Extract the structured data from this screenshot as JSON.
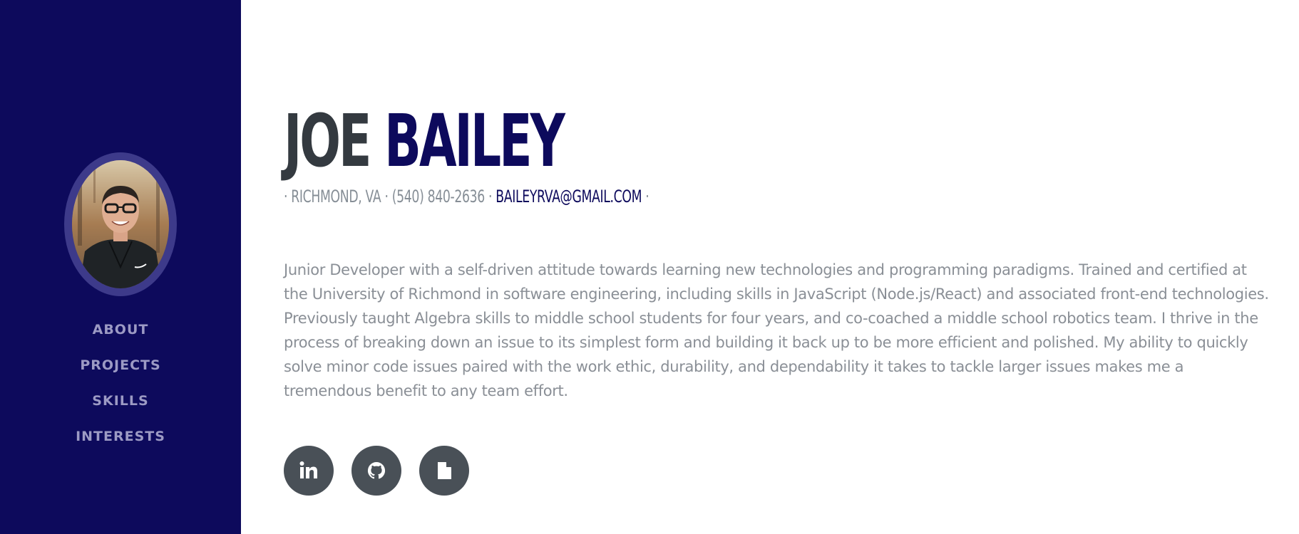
{
  "profile": {
    "first_name": "JOE",
    "last_name": "BAILEY",
    "sep1": "· ",
    "location": "RICHMOND, VA",
    "sep2": " · ",
    "phone": "(540) 840-2636",
    "sep3": " · ",
    "email": "BAILEYRVA@GMAIL.COM",
    "sep4": " ·",
    "bio": "Junior Developer with a self-driven attitude towards learning new technologies and programming paradigms. Trained and certified at the University of Richmond in software engineering, including skills in JavaScript (Node.js/React) and associated front-end technologies. Previously taught Algebra skills to middle school students for four years, and co-coached a middle school robotics team. I thrive in the process of breaking down an issue to its simplest form and building it back up to be more efficient and polished. My ability to quickly solve minor code issues paired with the work ethic, durability, and dependability it takes to tackle larger issues makes me a tremendous benefit to any team effort."
  },
  "sidebar": {
    "nav": [
      {
        "label": "ABOUT"
      },
      {
        "label": "PROJECTS"
      },
      {
        "label": "SKILLS"
      },
      {
        "label": "INTERESTS"
      }
    ]
  },
  "social": [
    {
      "icon": "linkedin-icon"
    },
    {
      "icon": "github-icon"
    },
    {
      "icon": "document-icon"
    }
  ],
  "colors": {
    "sidebar_bg": "#0d0a5c",
    "accent": "#0d0a5c",
    "heading_gray": "#343a40",
    "text_gray": "#868e96",
    "icon_bg": "#495057"
  }
}
